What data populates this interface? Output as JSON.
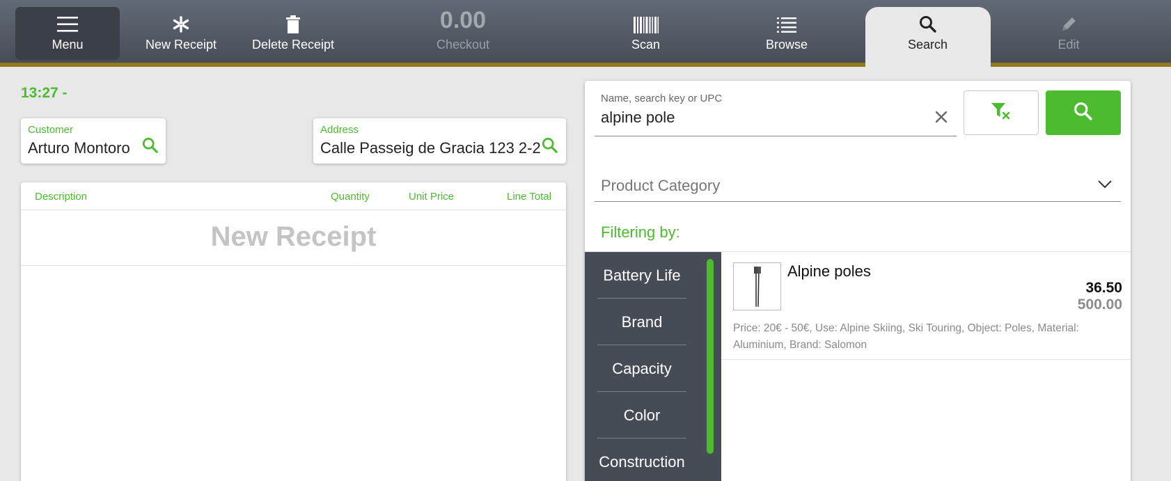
{
  "toolbar": {
    "menu_label": "Menu",
    "new_receipt_label": "New Receipt",
    "delete_receipt_label": "Delete Receipt",
    "checkout_amount": "0.00",
    "checkout_label": "Checkout",
    "scan_label": "Scan",
    "browse_label": "Browse",
    "search_label": "Search",
    "edit_label": "Edit"
  },
  "receipt": {
    "time": "13:27 -",
    "customer_label": "Customer",
    "customer_value": "Arturo Montoro",
    "address_label": "Address",
    "address_value": "Calle Passeig de Gracia 123 2-2",
    "columns": [
      "Description",
      "Quantity",
      "Unit Price",
      "Line Total"
    ],
    "empty_title": "New Receipt"
  },
  "search": {
    "placeholder": "Name, search key or UPC",
    "value": "alpine pole",
    "category_placeholder": "Product Category",
    "filtering_label": "Filtering by:",
    "facets": [
      "Battery Life",
      "Brand",
      "Capacity",
      "Color",
      "Construction"
    ],
    "results": [
      {
        "name": "Alpine poles",
        "price": "36.50",
        "price_secondary": "500.00",
        "description": "Price: 20€ - 50€, Use: Alpine Skiing, Ski Touring, Object: Poles, Material: Aluminium, Brand: Salomon"
      }
    ]
  },
  "colors": {
    "accent": "#4cbb2f",
    "toolbar": "#535a65",
    "toolbar_border": "#8f7a1e",
    "facet_bg": "#464c55"
  },
  "icons": {
    "menu": "hamburger-icon",
    "new_receipt": "asterisk-icon",
    "delete_receipt": "trash-icon",
    "scan": "barcode-icon",
    "browse": "list-icon",
    "search": "magnifier-icon",
    "edit": "pencil-icon",
    "clear_filter": "filter-clear-icon",
    "clear_text": "close-icon",
    "dropdown": "chevron-down-icon"
  }
}
